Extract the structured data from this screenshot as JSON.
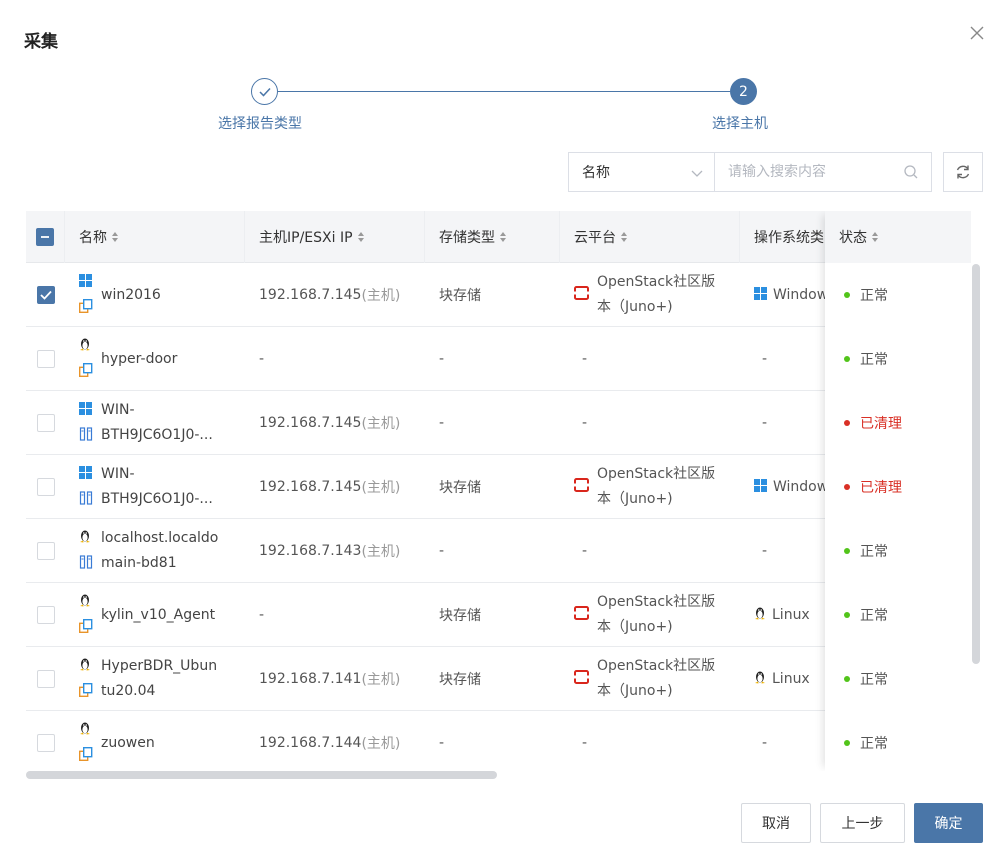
{
  "dialog": {
    "title": "采集",
    "steps": [
      {
        "label": "选择报告类型",
        "state": "done"
      },
      {
        "label": "选择主机",
        "number": "2",
        "state": "active"
      }
    ]
  },
  "search": {
    "field_selected": "名称",
    "placeholder": "请输入搜索内容"
  },
  "table": {
    "columns": [
      "名称",
      "主机IP/ESXi IP",
      "存储类型",
      "云平台",
      "操作系统类",
      "状态"
    ],
    "host_suffix": "(主机)",
    "rows": [
      {
        "checked": true,
        "os_icon": "windows-icon",
        "type_icon": "copy-icon",
        "name": "win2016",
        "name2": "",
        "ip": "192.168.7.145",
        "ip_suffix": "(主机)",
        "storage": "块存储",
        "cloud_line1": "OpenStack社区版",
        "cloud_line2": "本（Juno+)",
        "os": "Window",
        "os_icon2": "windows-icon",
        "status": "正常",
        "status_color": "#52c41a"
      },
      {
        "checked": false,
        "os_icon": "linux-icon",
        "type_icon": "copy-icon",
        "name": "hyper-door",
        "name2": "",
        "ip": "-",
        "ip_suffix": "",
        "storage": "-",
        "cloud_line1": "-",
        "cloud_line2": "",
        "os": "-",
        "os_icon2": "",
        "status": "正常",
        "status_color": "#52c41a"
      },
      {
        "checked": false,
        "os_icon": "windows-icon",
        "type_icon": "vm-icon",
        "name": "WIN-",
        "name2": "BTH9JC6O1J0-...",
        "ip": "192.168.7.145",
        "ip_suffix": "(主机)",
        "storage": "-",
        "cloud_line1": "-",
        "cloud_line2": "",
        "os": "-",
        "os_icon2": "",
        "status": "已清理",
        "status_color": "#d93026"
      },
      {
        "checked": false,
        "os_icon": "windows-icon",
        "type_icon": "vm-icon",
        "name": "WIN-",
        "name2": "BTH9JC6O1J0-...",
        "ip": "192.168.7.145",
        "ip_suffix": "(主机)",
        "storage": "块存储",
        "cloud_line1": "OpenStack社区版",
        "cloud_line2": "本（Juno+)",
        "os": "Window",
        "os_icon2": "windows-icon",
        "status": "已清理",
        "status_color": "#d93026"
      },
      {
        "checked": false,
        "os_icon": "linux-icon",
        "type_icon": "vm-icon",
        "name": "localhost.localdo",
        "name2": "main-bd81",
        "ip": "192.168.7.143",
        "ip_suffix": "(主机)",
        "storage": "-",
        "cloud_line1": "-",
        "cloud_line2": "",
        "os": "-",
        "os_icon2": "",
        "status": "正常",
        "status_color": "#52c41a"
      },
      {
        "checked": false,
        "os_icon": "linux-icon",
        "type_icon": "copy-icon",
        "name": "kylin_v10_Agent",
        "name2": "",
        "ip": "-",
        "ip_suffix": "",
        "storage": "块存储",
        "cloud_line1": "OpenStack社区版",
        "cloud_line2": "本（Juno+)",
        "os": "Linux",
        "os_icon2": "linux-icon",
        "status": "正常",
        "status_color": "#52c41a"
      },
      {
        "checked": false,
        "os_icon": "linux-icon",
        "type_icon": "copy-icon",
        "name": "HyperBDR_Ubun",
        "name2": "tu20.04",
        "ip": "192.168.7.141",
        "ip_suffix": "(主机)",
        "storage": "块存储",
        "cloud_line1": "OpenStack社区版",
        "cloud_line2": "本（Juno+)",
        "os": "Linux",
        "os_icon2": "linux-icon",
        "status": "正常",
        "status_color": "#52c41a"
      },
      {
        "checked": false,
        "os_icon": "linux-icon",
        "type_icon": "copy-icon",
        "name": "zuowen",
        "name2": "",
        "ip": "192.168.7.144",
        "ip_suffix": "(主机)",
        "storage": "-",
        "cloud_line1": "-",
        "cloud_line2": "",
        "os": "-",
        "os_icon2": "",
        "status": "正常",
        "status_color": "#52c41a"
      }
    ]
  },
  "footer": {
    "cancel_label": "取消",
    "prev_label": "上一步",
    "ok_label": "确定"
  },
  "colors": {
    "primary": "#4a76a8",
    "success": "#52c41a",
    "danger": "#d93026",
    "openstack": "#d9261c",
    "windows": "#2b8fe0",
    "copy_orange": "#e8942a",
    "copy_blue": "#2b8fe0"
  }
}
